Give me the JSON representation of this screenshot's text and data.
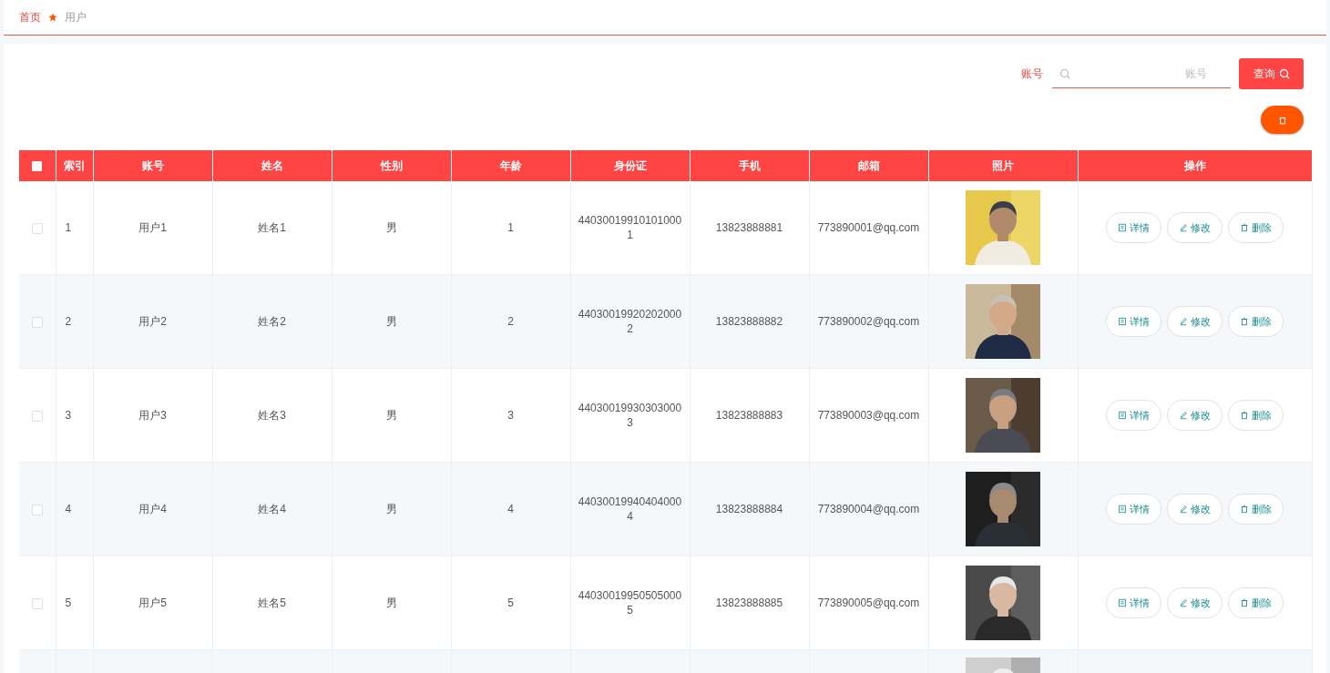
{
  "breadcrumb": [
    {
      "label": "首页",
      "selected": false
    },
    {
      "label": "用户",
      "selected": true
    }
  ],
  "search": {
    "label": "账号",
    "placeholder": "账号",
    "button": "查询"
  },
  "table": {
    "all_checked": false,
    "columns": [
      "索引",
      "账号",
      "姓名",
      "性别",
      "年龄",
      "身份证",
      "手机",
      "邮箱",
      "照片",
      "操作"
    ],
    "rows": [
      {
        "kind": "full",
        "checked": false,
        "index": "1",
        "account": "用户1",
        "name": "姓名1",
        "gender": "男",
        "age": "1",
        "id_card": "440300199101010001",
        "phone": "13823888881",
        "email": "773890001@qq.com",
        "actions": [
          "详情",
          "修改",
          "删除"
        ]
      },
      {
        "kind": "full",
        "checked": false,
        "index": "2",
        "account": "用户2",
        "name": "姓名2",
        "gender": "男",
        "age": "2",
        "id_card": "440300199202020002",
        "phone": "13823888882",
        "email": "773890002@qq.com",
        "actions": [
          "详情",
          "修改",
          "删除"
        ]
      },
      {
        "kind": "full",
        "checked": false,
        "index": "3",
        "account": "用户3",
        "name": "姓名3",
        "gender": "男",
        "age": "3",
        "id_card": "440300199303030003",
        "phone": "13823888883",
        "email": "773890003@qq.com",
        "actions": [
          "详情",
          "修改",
          "删除"
        ]
      },
      {
        "kind": "full",
        "checked": false,
        "index": "4",
        "account": "用户4",
        "name": "姓名4",
        "gender": "男",
        "age": "4",
        "id_card": "440300199404040004",
        "phone": "13823888884",
        "email": "773890004@qq.com",
        "actions": [
          "详情",
          "修改",
          "删除"
        ]
      },
      {
        "kind": "full",
        "checked": false,
        "index": "5",
        "account": "用户5",
        "name": "姓名5",
        "gender": "男",
        "age": "5",
        "id_card": "440300199505050005",
        "phone": "13823888885",
        "email": "773890005@qq.com",
        "actions": [
          "详情",
          "修改",
          "删除"
        ]
      },
      {
        "kind": "partial"
      }
    ]
  }
}
